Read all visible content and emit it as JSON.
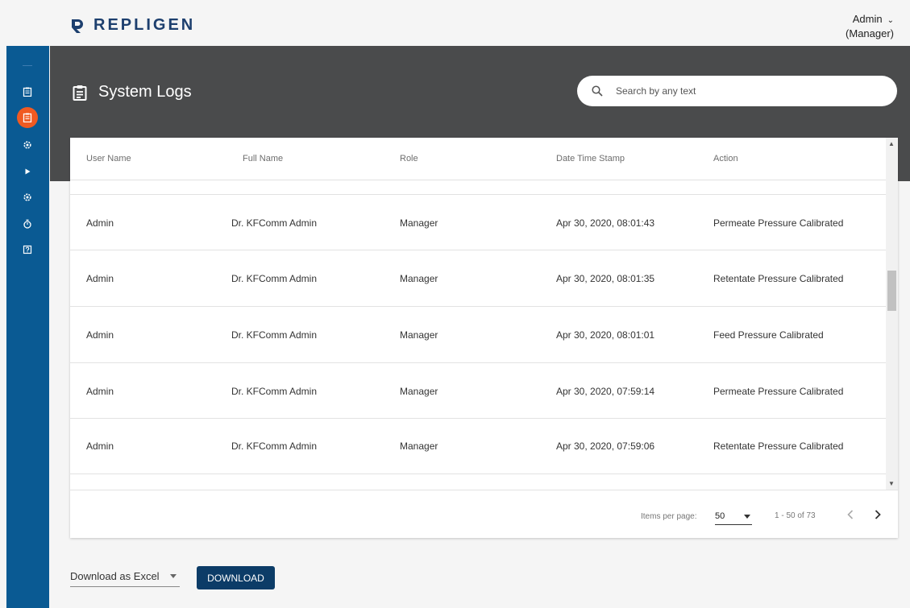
{
  "brand": {
    "name": "REPLIGEN",
    "mark_color": "#1d3f6e",
    "accent_color": "#f05a22",
    "sidebar_color": "#0a5a93"
  },
  "user_menu": {
    "name": "Admin",
    "role": "(Manager)",
    "icon": "chevron-down-icon"
  },
  "sidebar": {
    "items": [
      {
        "icon": "clipboard-icon",
        "active": false
      },
      {
        "icon": "clipboard-icon",
        "active": true
      },
      {
        "icon": "gear-icon",
        "active": false
      },
      {
        "icon": "play-icon",
        "active": false
      },
      {
        "icon": "gear-icon",
        "active": false
      },
      {
        "icon": "stopwatch-icon",
        "active": false
      },
      {
        "icon": "help-icon",
        "active": false
      }
    ]
  },
  "page": {
    "title": "System Logs",
    "title_icon": "clipboard-icon"
  },
  "search": {
    "placeholder": "Search by any text",
    "value": ""
  },
  "table": {
    "columns": [
      "User Name",
      "Full Name",
      "Role",
      "Date Time Stamp",
      "Action"
    ],
    "rows": [
      [
        "Admin",
        "Dr. KFComm Admin",
        "Manager",
        "Apr 30, 2020, 08:01:43",
        "Permeate Pressure Calibrated"
      ],
      [
        "Admin",
        "Dr. KFComm Admin",
        "Manager",
        "Apr 30, 2020, 08:01:35",
        "Retentate Pressure Calibrated"
      ],
      [
        "Admin",
        "Dr. KFComm Admin",
        "Manager",
        "Apr 30, 2020, 08:01:01",
        "Feed Pressure Calibrated"
      ],
      [
        "Admin",
        "Dr. KFComm Admin",
        "Manager",
        "Apr 30, 2020, 07:59:14",
        "Permeate Pressure Calibrated"
      ],
      [
        "Admin",
        "Dr. KFComm Admin",
        "Manager",
        "Apr 30, 2020, 07:59:06",
        "Retentate Pressure Calibrated"
      ]
    ]
  },
  "paginator": {
    "items_per_page_label": "Items per page:",
    "items_per_page": "50",
    "range": "1 - 50 of 73"
  },
  "export": {
    "format": "Download as Excel",
    "button": "DOWNLOAD"
  }
}
